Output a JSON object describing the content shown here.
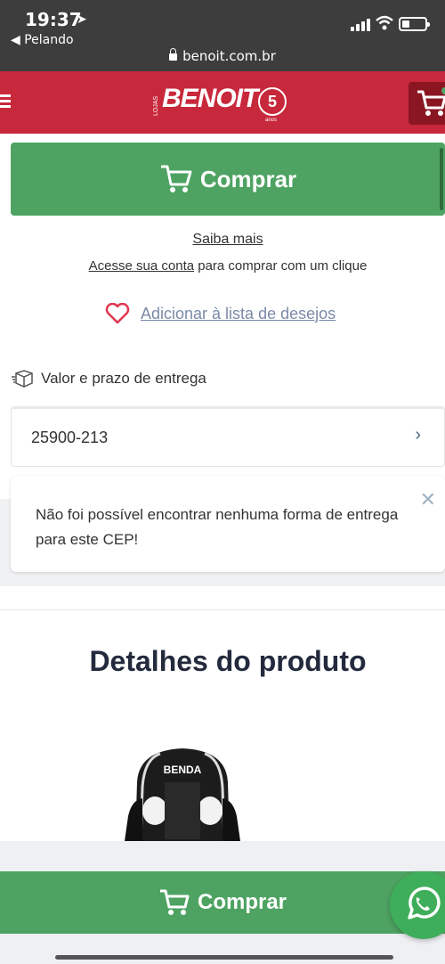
{
  "status_bar": {
    "time": "19:37",
    "back_app": "◀ Pelando",
    "url": "benoit.com.br"
  },
  "header": {
    "logo": "BENOIT",
    "logo_small": "LOJAS",
    "logo_badge": "5",
    "logo_anos": "anos"
  },
  "buy_top": {
    "label": "Comprar"
  },
  "saiba_mais": "Saiba mais",
  "acesse": {
    "link": "Acesse sua conta",
    "rest": " para comprar com um clique"
  },
  "wishlist": {
    "label": "Adicionar à lista de desejos"
  },
  "shipping": {
    "title": "Valor e prazo de entrega",
    "cep": "25900-213"
  },
  "alert": {
    "message": "Não foi possível encontrar nenhuma forma de entrega para este CEP!"
  },
  "details": {
    "title": "Detalhes do produto",
    "chair_brand": "BENDA"
  },
  "buy_bottom": {
    "label": "Comprar"
  },
  "colors": {
    "brand_red": "#c8283b",
    "buy_green": "#4ea362",
    "whatsapp_green": "#3fae5a",
    "wish_heart": "#e0364f"
  },
  "icons": [
    "location-arrow-icon",
    "signal-icon",
    "wifi-icon",
    "battery-icon",
    "lock-icon",
    "menu-icon",
    "cart-icon",
    "heart-icon",
    "box-icon",
    "chevron-right-icon",
    "close-icon",
    "whatsapp-icon"
  ]
}
